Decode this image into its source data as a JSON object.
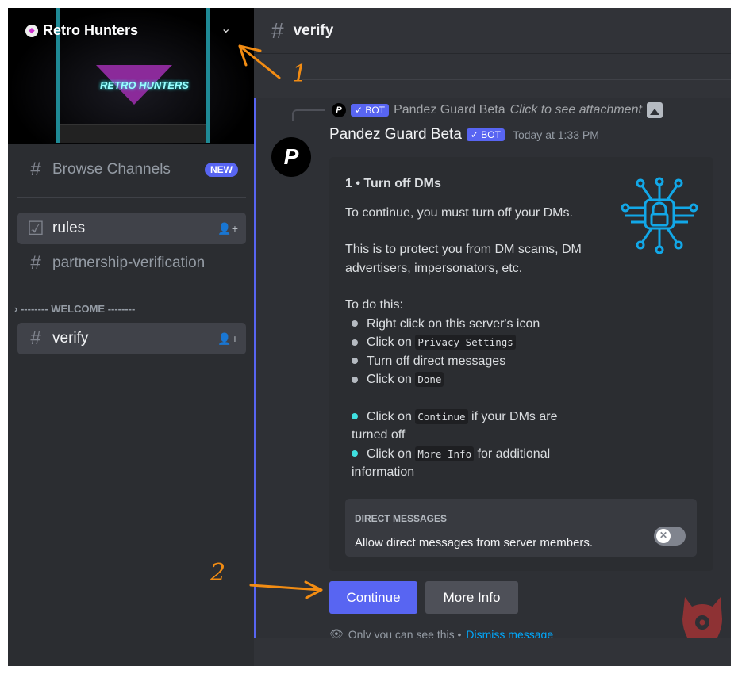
{
  "server": {
    "name": "Retro Hunters",
    "banner_logo": "RETRO HUNTERS"
  },
  "sidebar": {
    "browse": {
      "label": "Browse Channels",
      "badge": "NEW"
    },
    "channels": [
      {
        "label": "rules"
      },
      {
        "label": "partnership-verification"
      }
    ],
    "category": "-------- WELCOME --------",
    "welcome_channels": [
      {
        "label": "verify"
      }
    ]
  },
  "header": {
    "channel": "verify"
  },
  "message": {
    "reply": {
      "author": "Pandez Guard Beta",
      "badge": "✓ BOT",
      "text": "Click to see attachment"
    },
    "author": "Pandez Guard Beta",
    "badge": "✓ BOT",
    "timestamp": "Today at 1:33 PM",
    "avatar_letter": "P",
    "embed": {
      "title": "1 • Turn off DMs",
      "p1": "To continue, you must turn off your DMs.",
      "p2": "This is to protect you from DM scams, DM advertisers, impersonators, etc.",
      "steps_intro": "To do this:",
      "steps": [
        {
          "pre": "Right click on this server's icon",
          "code": "",
          "post": ""
        },
        {
          "pre": "Click on ",
          "code": "Privacy Settings",
          "post": ""
        },
        {
          "pre": "Turn off direct messages",
          "code": "",
          "post": ""
        },
        {
          "pre": "Click on ",
          "code": "Done",
          "post": ""
        }
      ],
      "actions": [
        {
          "pre": "Click on ",
          "code": "Continue",
          "post": " if your DMs are turned off"
        },
        {
          "pre": "Click on ",
          "code": "More Info",
          "post": " for additional information"
        }
      ],
      "setting": {
        "label": "DIRECT MESSAGES",
        "text": "Allow direct messages from server members.",
        "enabled": false
      }
    },
    "buttons": {
      "continue": "Continue",
      "more_info": "More Info"
    },
    "ephemeral": {
      "text": "Only you can see this •",
      "dismiss": "Dismiss message"
    }
  },
  "annotations": {
    "a1": "1",
    "a2": "2"
  },
  "colors": {
    "accent": "#5865f2",
    "annotation": "#f28c13",
    "link": "#00a8fc"
  }
}
